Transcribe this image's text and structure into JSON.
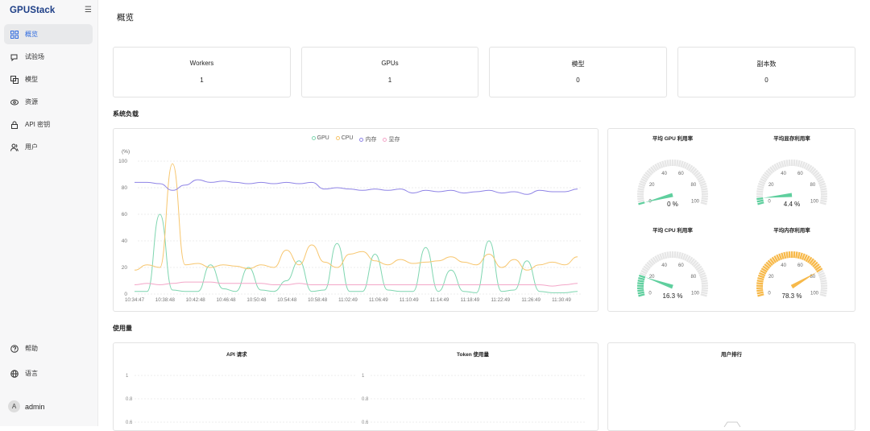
{
  "app": {
    "logo": "GPUStack",
    "collapse_icon": "menu-fold-icon"
  },
  "sidebar": {
    "items": [
      {
        "label": "概览",
        "icon": "dashboard-icon",
        "active": true
      },
      {
        "label": "试验场",
        "icon": "playground-icon",
        "active": false
      },
      {
        "label": "模型",
        "icon": "model-icon",
        "active": false
      },
      {
        "label": "资源",
        "icon": "resources-icon",
        "active": false
      },
      {
        "label": "API 密钥",
        "icon": "lock-icon",
        "active": false
      },
      {
        "label": "用户",
        "icon": "users-icon",
        "active": false
      }
    ],
    "help": {
      "label": "帮助",
      "icon": "help-icon"
    },
    "language": {
      "label": "语言",
      "icon": "globe-icon"
    },
    "user": {
      "avatar": "A",
      "name": "admin"
    }
  },
  "page": {
    "title": "概览"
  },
  "stats": [
    {
      "label": "Workers",
      "value": "1"
    },
    {
      "label": "GPUs",
      "value": "1"
    },
    {
      "label": "模型",
      "value": "0"
    },
    {
      "label": "副本数",
      "value": "0"
    }
  ],
  "system_load": {
    "title": "系统负载",
    "legend": [
      {
        "name": "GPU",
        "color": "#7fd6b0"
      },
      {
        "name": "CPU",
        "color": "#f7c66e"
      },
      {
        "name": "内存",
        "color": "#8f84e6"
      },
      {
        "name": "显存",
        "color": "#f3a6c8"
      }
    ],
    "gauges": [
      {
        "title": "平均 GPU 利用率",
        "value": 0,
        "label": "0 %",
        "color": "#5fcf9e"
      },
      {
        "title": "平均显存利用率",
        "value": 4.4,
        "label": "4.4 %",
        "color": "#5fcf9e"
      },
      {
        "title": "平均 CPU 利用率",
        "value": 16.3,
        "label": "16.3 %",
        "color": "#5fcf9e"
      },
      {
        "title": "平均内存利用率",
        "value": 78.3,
        "label": "78.3 %",
        "color": "#f7b94a"
      }
    ],
    "gauge_ticks": [
      "0",
      "20",
      "40",
      "60",
      "80",
      "100"
    ]
  },
  "usage": {
    "title": "使用量",
    "api_title": "API 请求",
    "token_title": "Token 使用量",
    "rank_title": "用户排行",
    "y_ticks": [
      "1",
      "0.8",
      "0.6"
    ]
  },
  "chart_data": {
    "type": "line",
    "ylabel": "(%)",
    "ylim": [
      0,
      100
    ],
    "y_ticks": [
      0,
      20,
      40,
      60,
      80,
      100
    ],
    "categories": [
      "10:34:47",
      "10:38:48",
      "10:42:48",
      "10:46:48",
      "10:50:48",
      "10:54:48",
      "10:58:48",
      "11:02:49",
      "11:06:49",
      "11:10:49",
      "11:14:49",
      "11:18:49",
      "11:22:49",
      "11:26:49",
      "11:30:49"
    ],
    "grid": true,
    "legend_position": "top-center",
    "series": [
      {
        "name": "GPU",
        "values": [
          2,
          2,
          60,
          3,
          2,
          2,
          22,
          4,
          2,
          20,
          3,
          2,
          10,
          25,
          2,
          3,
          38,
          2,
          2,
          30,
          3,
          2,
          2,
          35,
          2,
          18,
          2,
          1,
          40,
          2,
          3,
          25,
          2,
          1,
          1,
          2
        ]
      },
      {
        "name": "CPU",
        "values": [
          18,
          22,
          20,
          98,
          22,
          23,
          20,
          22,
          21,
          19,
          22,
          20,
          33,
          22,
          37,
          24,
          20,
          30,
          32,
          25,
          22,
          26,
          23,
          24,
          25,
          28,
          24,
          22,
          30,
          20,
          26,
          18,
          22,
          24,
          22,
          28
        ]
      },
      {
        "name": "内存",
        "values": [
          84,
          84,
          83,
          78,
          82,
          86,
          84,
          85,
          84,
          83,
          84,
          83,
          84,
          83,
          84,
          79,
          80,
          79,
          78,
          79,
          78,
          79,
          76,
          78,
          77,
          78,
          76,
          77,
          78,
          76,
          77,
          75,
          78,
          77,
          77,
          79
        ]
      },
      {
        "name": "显存",
        "values": [
          7,
          8,
          7,
          8,
          9,
          9,
          9,
          8,
          8,
          8,
          8,
          7,
          7,
          8,
          7,
          7,
          7,
          7,
          7,
          7,
          7,
          7,
          7,
          7,
          7,
          7,
          7,
          7,
          7,
          7,
          7,
          7,
          7,
          6,
          7,
          8
        ]
      }
    ]
  }
}
